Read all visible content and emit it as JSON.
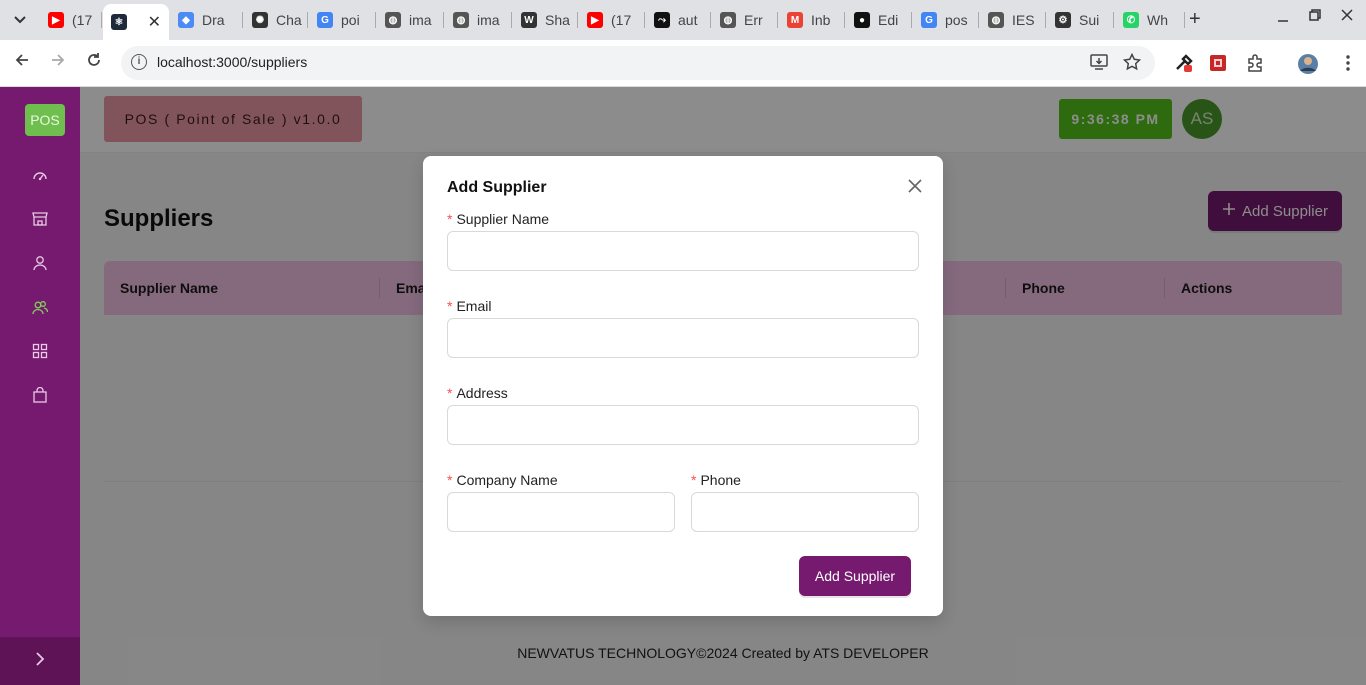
{
  "browser": {
    "tabs": [
      {
        "label": "(17",
        "icon": "youtube-icon",
        "color": "#ff0000"
      },
      {
        "label": "",
        "icon": "react-icon",
        "color": "#1e293b",
        "active": true
      },
      {
        "label": "Dra",
        "icon": "diagram-icon",
        "color": "#4c8bf5"
      },
      {
        "label": "Cha",
        "icon": "chatgpt-icon",
        "color": "#333333"
      },
      {
        "label": "poi",
        "icon": "google-icon",
        "color": "#4285f4"
      },
      {
        "label": "ima",
        "icon": "globe-icon",
        "color": "#555555"
      },
      {
        "label": "ima",
        "icon": "globe-icon",
        "color": "#555555"
      },
      {
        "label": "Sha",
        "icon": "wikipedia-icon",
        "color": "#333333"
      },
      {
        "label": "(17",
        "icon": "youtube-icon",
        "color": "#ff0000"
      },
      {
        "label": "aut",
        "icon": "workflow-icon",
        "color": "#111111"
      },
      {
        "label": "Err",
        "icon": "globe-icon",
        "color": "#555555"
      },
      {
        "label": "Inb",
        "icon": "gmail-icon",
        "color": "#ea4335"
      },
      {
        "label": "Edi",
        "icon": "github-icon",
        "color": "#111111"
      },
      {
        "label": "pos",
        "icon": "google-icon",
        "color": "#4285f4"
      },
      {
        "label": "IES",
        "icon": "globe-icon",
        "color": "#555555"
      },
      {
        "label": "Sui",
        "icon": "gear-icon",
        "color": "#333333"
      },
      {
        "label": "Wh",
        "icon": "whatsapp-icon",
        "color": "#25d366"
      }
    ],
    "url": "localhost:3000/suppliers"
  },
  "app": {
    "logo": "POS",
    "brand": "POS ( Point of Sale ) v1.0.0",
    "clock": "9:36:38 PM",
    "avatar": "AS",
    "page_title": "Suppliers",
    "add_button": "Add Supplier",
    "table_headers": [
      "Supplier Name",
      "Ema",
      "Phone",
      "Actions"
    ],
    "footer": "NEWVATUS TECHNOLOGY©2024 Created by ATS DEVELOPER",
    "colors": {
      "primary": "#751a6e",
      "accent_green": "#52c41a",
      "table_head": "#f3c1e6",
      "brand_bg": "#ec9aa8"
    }
  },
  "modal": {
    "title": "Add Supplier",
    "fields": {
      "supplier_name": {
        "label": "Supplier Name",
        "value": ""
      },
      "email": {
        "label": "Email",
        "value": ""
      },
      "address": {
        "label": "Address",
        "value": ""
      },
      "company_name": {
        "label": "Company Name",
        "value": ""
      },
      "phone": {
        "label": "Phone",
        "value": ""
      }
    },
    "submit": "Add Supplier"
  }
}
